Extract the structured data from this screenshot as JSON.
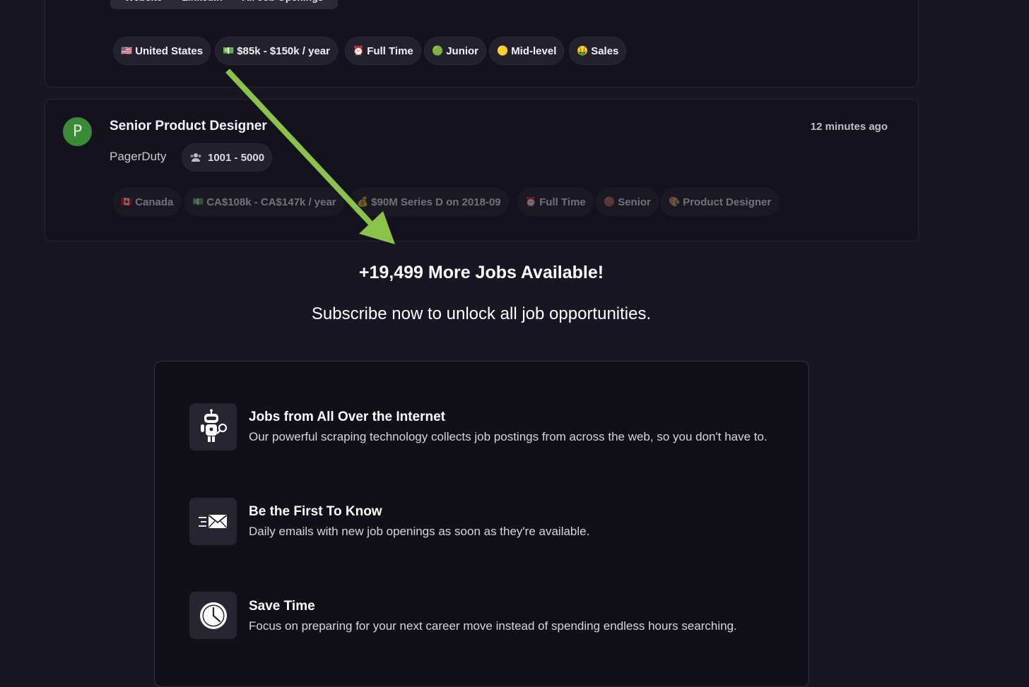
{
  "top_links": [
    "Website",
    "LinkedIn",
    "All Job Openings"
  ],
  "job1": {
    "tags": [
      {
        "emoji": "🇺🇸",
        "label": "United States"
      },
      {
        "emoji": "💵",
        "label": "$85k - $150k / year"
      },
      {
        "emoji": "⏰",
        "label": "Full Time"
      },
      {
        "emoji": "🟢",
        "label": "Junior"
      },
      {
        "emoji": "🟡",
        "label": "Mid-level"
      },
      {
        "emoji": "🤑",
        "label": "Sales"
      }
    ]
  },
  "job2": {
    "avatar_letter": "P",
    "title": "Senior Product Designer",
    "company": "PagerDuty",
    "size_icon": "people-icon",
    "size": "1001 - 5000",
    "posted": "12 minutes ago",
    "tags": [
      {
        "emoji": "🇨🇦",
        "label": "Canada"
      },
      {
        "emoji": "💵",
        "label": "CA$108k - CA$147k / year"
      },
      {
        "emoji": "💰",
        "label": "$90M Series D on 2018-09"
      },
      {
        "emoji": "⏰",
        "label": "Full Time"
      },
      {
        "emoji": "🟤",
        "label": "Senior"
      },
      {
        "emoji": "🎨",
        "label": "Product Designer"
      }
    ]
  },
  "paywall": {
    "headline": "+19,499 More Jobs Available!",
    "subline": "Subscribe now to unlock all job opportunities."
  },
  "features": [
    {
      "icon": "robot-search-icon",
      "title": "Jobs from All Over the Internet",
      "desc": "Our powerful scraping technology collects job postings from across the web, so you don't have to."
    },
    {
      "icon": "envelope-fast-icon",
      "title": "Be the First To Know",
      "desc": "Daily emails with new job openings as soon as they're available."
    },
    {
      "icon": "clock-icon",
      "title": "Save Time",
      "desc": "Focus on preparing for your next career move instead of spending endless hours searching."
    }
  ],
  "colors": {
    "background": "#171622",
    "avatar": "#3a8a3a",
    "arrow": "#8bc34a"
  }
}
